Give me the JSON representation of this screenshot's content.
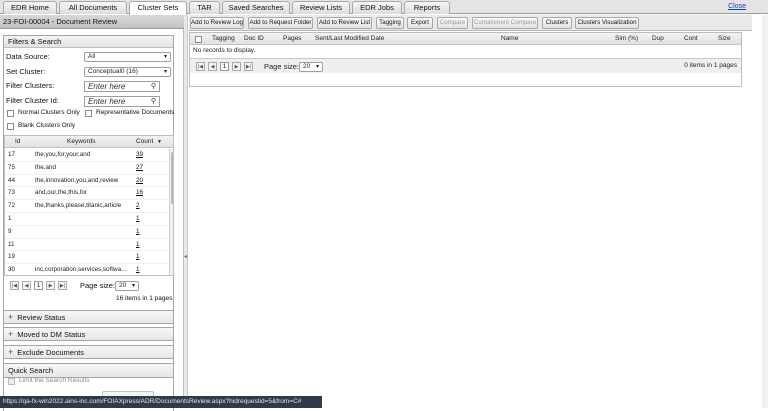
{
  "tabs": [
    {
      "label": "EDR Home"
    },
    {
      "label": "All Documents"
    },
    {
      "label": "Cluster Sets"
    },
    {
      "label": "TAR"
    },
    {
      "label": "Saved Searches"
    },
    {
      "label": "Review Lists"
    },
    {
      "label": "EDR Jobs"
    },
    {
      "label": "Reports"
    }
  ],
  "active_tab": "Cluster Sets",
  "close_label": "Close",
  "case_title": "23-FOI-00004 - Document Review",
  "filters": {
    "title": "Filters & Search",
    "data_source_label": "Data Source:",
    "data_source_value": "All",
    "set_cluster_label": "Set Cluster:",
    "set_cluster_value": "Conceptual0 (16)",
    "filter_clusters_label": "Filter Clusters:",
    "filter_clusters_placeholder": "Enter here",
    "filter_cluster_id_label": "Filter Cluster Id:",
    "filter_cluster_id_placeholder": "Enter here",
    "normal_only_label": "Normal Clusters Only",
    "representative_label": "Representative Documents",
    "blank_only_label": "Blank Clusters Only"
  },
  "keyword_grid": {
    "headers": {
      "id": "Id",
      "keywords": "Keywords",
      "count": "Count"
    },
    "rows": [
      {
        "id": "17",
        "keywords": "the,you,for,your,and",
        "count": "39"
      },
      {
        "id": "75",
        "keywords": "the,and",
        "count": "27"
      },
      {
        "id": "44",
        "keywords": "the,innovation,you,and,review",
        "count": "20"
      },
      {
        "id": "73",
        "keywords": "and,our,the,this,for",
        "count": "16"
      },
      {
        "id": "72",
        "keywords": "the,thanks,please,titanic,article",
        "count": "2"
      },
      {
        "id": "1",
        "keywords": "",
        "count": "1"
      },
      {
        "id": "9",
        "keywords": "",
        "count": "1"
      },
      {
        "id": "11",
        "keywords": "",
        "count": "1"
      },
      {
        "id": "19",
        "keywords": "",
        "count": "1"
      },
      {
        "id": "30",
        "keywords": "inc,corporation,services,softwa...",
        "count": "1"
      }
    ],
    "page": "1",
    "page_size_label": "Page size:",
    "page_size_value": "20",
    "summary": "16 items in 1 pages"
  },
  "sections": {
    "review_status": "Review Status",
    "moved_to_dm": "Moved to DM Status",
    "exclude_documents": "Exclude Documents",
    "quick_search": "Quick Search",
    "limit_search_label": "Limit the Search Results"
  },
  "toolbar": {
    "add_to_review_log": "Add to Review Log",
    "add_to_request_folder": "Add to Request Folder",
    "add_to_review_list": "Add to Review List",
    "tagging": "Tagging",
    "export": "Export",
    "compare": "Compare",
    "containment_compare": "Containment Compare",
    "clusters": "Clusters",
    "clusters_visualization": "Clusters Visualization"
  },
  "doc_grid": {
    "headers": {
      "tagging": "Tagging",
      "doc_id": "Doc ID",
      "pages": "Pages",
      "sent_modified": "Sent/Last Modified Date",
      "name": "Name",
      "sim": "Sim (%)",
      "dup": "Dup",
      "cont": "Cont",
      "size": "Size"
    },
    "empty_message": "No records to display.",
    "page": "1",
    "page_size_label": "Page size:",
    "page_size_value": "20",
    "summary": "0 items in 1 pages"
  },
  "status_url": "https://qa-fx-win2022.ains-inc.com/FOIAXpress/ADR/DocumentsReview.aspx?hidrequestid=5&from=C#"
}
